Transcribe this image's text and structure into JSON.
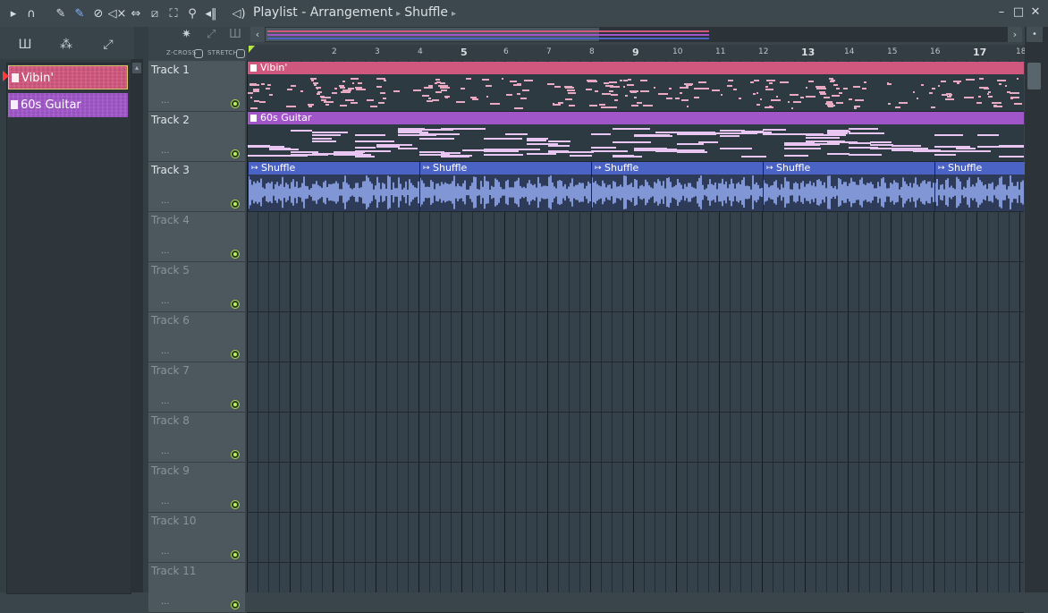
{
  "window": {
    "title_parts": [
      "Playlist",
      "Arrangement",
      "Shuffle"
    ],
    "title_sep": "-"
  },
  "picker": {
    "items": [
      {
        "label": "Vibin'",
        "color": "#d0577d",
        "selected": true
      },
      {
        "label": "60s Guitar",
        "color": "#a056c8",
        "selected": false
      }
    ]
  },
  "toolbar2": {
    "zcross_label": "Z-CROSS",
    "stretch_label": "STRETCH"
  },
  "ruler": {
    "bars": [
      "2",
      "3",
      "4",
      "5",
      "6",
      "7",
      "8",
      "9",
      "10",
      "11",
      "12",
      "13",
      "14",
      "15",
      "16",
      "17",
      "18"
    ]
  },
  "tracks": [
    {
      "name": "Track 1",
      "active": true
    },
    {
      "name": "Track 2",
      "active": true
    },
    {
      "name": "Track 3",
      "active": true
    },
    {
      "name": "Track 4",
      "active": false
    },
    {
      "name": "Track 5",
      "active": false
    },
    {
      "name": "Track 6",
      "active": false
    },
    {
      "name": "Track 7",
      "active": false
    },
    {
      "name": "Track 8",
      "active": false
    },
    {
      "name": "Track 9",
      "active": false
    },
    {
      "name": "Track 10",
      "active": false
    },
    {
      "name": "Track 11",
      "active": false
    }
  ],
  "track_dots": "...",
  "clips": {
    "vibin": {
      "label": "Vibin'",
      "color": "#d0577d"
    },
    "guitar": {
      "label": "60s Guitar",
      "color": "#a056c8"
    },
    "shuffle": {
      "label": "Shuffle",
      "color": "#4a63c4",
      "count": 5
    }
  },
  "icons": [
    "play-arrow-icon",
    "magnet-icon",
    "pencil-icon",
    "brush-icon",
    "delete-icon",
    "mute-icon",
    "slip-icon",
    "slice-icon",
    "select-icon",
    "zoom-icon",
    "playback-icon",
    "speaker-icon",
    "minimize-icon",
    "maximize-icon",
    "close-icon"
  ]
}
